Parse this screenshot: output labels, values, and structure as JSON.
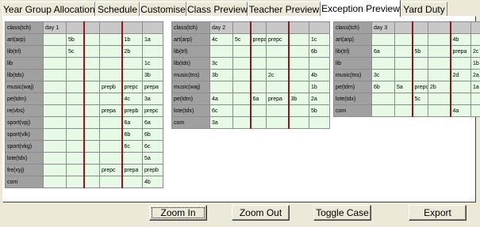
{
  "tabs": [
    "Year Group Allocation",
    "Schedule",
    "Customise",
    "Class Preview",
    "Teacher Preview",
    "Exception Preview",
    "Yard Duty"
  ],
  "active_tab": 5,
  "days": [
    {
      "header": [
        "class(tch)",
        "day 1",
        "",
        "",
        "",
        "",
        ""
      ],
      "rows": [
        [
          "art(arp)",
          "",
          "5b",
          "",
          "",
          "1b",
          "1a"
        ],
        [
          "lib(trl)",
          "",
          "5c",
          "",
          "",
          "2b",
          ""
        ],
        [
          "lib",
          "",
          "",
          "",
          "",
          "",
          "1c"
        ],
        [
          "lib(tds)",
          "",
          "",
          "",
          "",
          "",
          "3b"
        ],
        [
          "music(waj)",
          "",
          "",
          "",
          "prepb",
          "prepc",
          "prepa"
        ],
        [
          "pe(tdm)",
          "",
          "",
          "",
          "",
          "4c",
          "3a"
        ],
        [
          "re(vbs)",
          "",
          "",
          "",
          "prepa",
          "prepb",
          "prepc"
        ],
        [
          "sport(vpj)",
          "",
          "",
          "",
          "",
          "6a",
          "6a"
        ],
        [
          "sport(vlk)",
          "",
          "",
          "",
          "",
          "6b",
          "6b"
        ],
        [
          "sport(vkg)",
          "",
          "",
          "",
          "",
          "6c",
          "6c"
        ],
        [
          "lote(tdx)",
          "",
          "",
          "",
          "",
          "",
          "5a"
        ],
        [
          "fre(xyj)",
          "",
          "",
          "",
          "prepc",
          "prepa",
          "prepb"
        ],
        [
          "com",
          "",
          "",
          "",
          "",
          "",
          "4b"
        ]
      ]
    },
    {
      "header": [
        "class(tch)",
        "day 2",
        "",
        "",
        "",
        "",
        ""
      ],
      "rows": [
        [
          "art(arp)",
          "4c",
          "5c",
          "prepa",
          "prepc",
          "",
          "1c"
        ],
        [
          "lib(trl)",
          "",
          "",
          "",
          "",
          "",
          "6b"
        ],
        [
          "lib(tds)",
          "3c",
          "",
          "",
          "",
          "",
          ""
        ],
        [
          "music(tns)",
          "3b",
          "",
          "",
          "2c",
          "",
          "4b"
        ],
        [
          "music(waj)",
          "",
          "",
          "",
          "",
          "",
          "1b"
        ],
        [
          "pe(tdm)",
          "4a",
          "",
          "6a",
          "prepa",
          "3b",
          "2a"
        ],
        [
          "lote(tdx)",
          "6c",
          "",
          "",
          "",
          "",
          "5b"
        ],
        [
          "com",
          "3a",
          "",
          "",
          "",
          "",
          ""
        ]
      ]
    },
    {
      "header": [
        "class(tch)",
        "day 3",
        "",
        "",
        "",
        "",
        ""
      ],
      "rows": [
        [
          "art(arp)",
          "",
          "",
          "",
          "",
          "4b",
          ""
        ],
        [
          "lib(trl)",
          "6a",
          "",
          "5b",
          "",
          "prepa",
          "2c"
        ],
        [
          "lib",
          "",
          "",
          "",
          "",
          "",
          "1b"
        ],
        [
          "music(tns)",
          "3c",
          "",
          "",
          "",
          "2d",
          "2a"
        ],
        [
          "pe(tdm)",
          "6b",
          "5a",
          "prepc",
          "2b",
          "",
          "1a"
        ],
        [
          "lote(tdx)",
          "",
          "",
          "5c",
          "",
          "",
          ""
        ],
        [
          "com",
          "",
          "",
          "",
          "",
          "4a",
          ""
        ]
      ]
    }
  ],
  "buttons": {
    "zoom_in": "Zoom In",
    "zoom_out": "Zoom Out",
    "toggle_case": "Toggle Case",
    "export": "Export"
  },
  "colors": {
    "cell_fill": "#e6fae6",
    "label_fill": "#a0a0a0",
    "session_break": "#8b1a1a"
  }
}
